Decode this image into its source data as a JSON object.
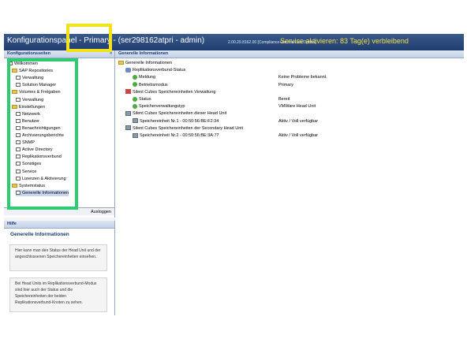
{
  "window": {
    "title": "Konfigurationspanel - Primary - (ser298162atpri - admin)",
    "version": "2.00.29.8162.00 [Compliance+ArchiveLink Option]",
    "service_notice": "Service aktivieren: 83 Tag(e) verbleibend",
    "collapse_icon": "double-chevron-left-icon"
  },
  "config_panel": {
    "header": "Konfigurationsseiten",
    "items": [
      {
        "label": "Willkommen",
        "level": 0,
        "type": "page"
      },
      {
        "label": "SAP Repositories",
        "level": 0,
        "type": "folder"
      },
      {
        "label": "Verwaltung",
        "level": 1,
        "type": "page"
      },
      {
        "label": "Solution Manager",
        "level": 1,
        "type": "page"
      },
      {
        "label": "Volumes & Freigaben",
        "level": 0,
        "type": "folder"
      },
      {
        "label": "Verwaltung",
        "level": 1,
        "type": "page"
      },
      {
        "label": "Einstellungen",
        "level": 0,
        "type": "folder"
      },
      {
        "label": "Netzwerk",
        "level": 1,
        "type": "page"
      },
      {
        "label": "Benutzer",
        "level": 1,
        "type": "page"
      },
      {
        "label": "Benachrichtigungen",
        "level": 1,
        "type": "page"
      },
      {
        "label": "Archivierungsberichte",
        "level": 1,
        "type": "page"
      },
      {
        "label": "SNMP",
        "level": 1,
        "type": "page"
      },
      {
        "label": "Active Directory",
        "level": 1,
        "type": "page"
      },
      {
        "label": "Replikationsverbund",
        "level": 1,
        "type": "page"
      },
      {
        "label": "Sonstiges",
        "level": 1,
        "type": "page"
      },
      {
        "label": "Service",
        "level": 1,
        "type": "page"
      },
      {
        "label": "Lizenzen & Aktivierung",
        "level": 1,
        "type": "page"
      },
      {
        "label": "Systemstatus",
        "level": 0,
        "type": "folder"
      },
      {
        "label": "Generelle Informationen",
        "level": 1,
        "type": "page"
      }
    ],
    "logout_label": "Ausloggen"
  },
  "help_panel": {
    "header": "Hilfe",
    "title": "Generelle Informationen",
    "paragraph1": "Hier kann man den Status der Head Unit und der angeschlossenen Speichereinheiten einsehen.",
    "paragraph2": "Bei Head Units im Replikationsverbund-Modus sind hier auch der Status und die Speichereinheiten der beiden Replikationsverbund-Knoten zu sehen."
  },
  "main": {
    "header": "Generelle Informationen",
    "tree": [
      {
        "label": "Generelle Informationen",
        "level": 0,
        "icon": "folder-icon",
        "value": ""
      },
      {
        "label": "Replikationsverbund-Status",
        "level": 1,
        "icon": "sync-icon",
        "value": ""
      },
      {
        "label": "Meldung",
        "level": 2,
        "icon": "status-ok-icon",
        "value": "Keine Probleme bekannt."
      },
      {
        "label": "Betriebsmodus",
        "level": 2,
        "icon": "status-ok-icon",
        "value": "Primary"
      },
      {
        "label": "Silent Cubes Speichereinheiten Verwaltung",
        "level": 1,
        "icon": "home-icon",
        "value": ""
      },
      {
        "label": "Status",
        "level": 2,
        "icon": "status-ok-icon",
        "value": "Bereit"
      },
      {
        "label": "Speicherverwaltungstyp",
        "level": 2,
        "icon": "status-ok-icon",
        "value": "VMWare Head Unit"
      },
      {
        "label": "Silent Cubes Speichereinheiten dieser Head Unit",
        "level": 1,
        "icon": "storage-icon",
        "value": ""
      },
      {
        "label": "Speichereinheit Nr.1 - 00:50:56:BE:F2:34",
        "level": 2,
        "icon": "storage-ok-icon",
        "value": "Aktiv / Voll verfügbar"
      },
      {
        "label": "Silent Cubes Speichereinheiten der Secondary Head Unit",
        "level": 1,
        "icon": "storage-icon",
        "value": ""
      },
      {
        "label": "Speichereinheit Nr.2 - 00:50:56:BE:3A:77",
        "level": 2,
        "icon": "storage-ok-icon",
        "value": "Aktiv / Voll verfügbar"
      }
    ]
  },
  "annotations": {
    "yellow_color": "#f2e21b",
    "green_color": "#2ecc71"
  }
}
